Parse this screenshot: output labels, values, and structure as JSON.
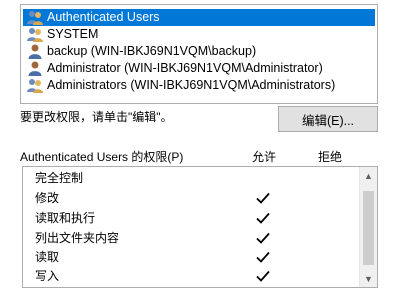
{
  "users": {
    "items": [
      {
        "label": "Authenticated Users",
        "icon": "users-group-icon",
        "selected": true
      },
      {
        "label": "SYSTEM",
        "icon": "users-group-icon",
        "selected": false
      },
      {
        "label": "backup (WIN-IBKJ69N1VQM\\backup)",
        "icon": "user-icon",
        "selected": false
      },
      {
        "label": "Administrator (WIN-IBKJ69N1VQM\\Administrator)",
        "icon": "user-icon",
        "selected": false
      },
      {
        "label": "Administrators (WIN-IBKJ69N1VQM\\Administrators)",
        "icon": "users-group-icon",
        "selected": false
      }
    ]
  },
  "hint_text": "要更改权限，请单击\"编辑\"。",
  "edit_button_label": "编辑(E)...",
  "permissions": {
    "title": "Authenticated Users 的权限(P)",
    "allow_header": "允许",
    "deny_header": "拒绝",
    "rows": [
      {
        "label": "完全控制",
        "allow": false,
        "deny": false
      },
      {
        "label": "修改",
        "allow": true,
        "deny": false
      },
      {
        "label": "读取和执行",
        "allow": true,
        "deny": false
      },
      {
        "label": "列出文件夹内容",
        "allow": true,
        "deny": false
      },
      {
        "label": "读取",
        "allow": true,
        "deny": false
      },
      {
        "label": "写入",
        "allow": true,
        "deny": false
      }
    ]
  },
  "colors": {
    "selection": "#0078d7",
    "button_bg": "#e1e1e1",
    "border": "#adadad"
  }
}
